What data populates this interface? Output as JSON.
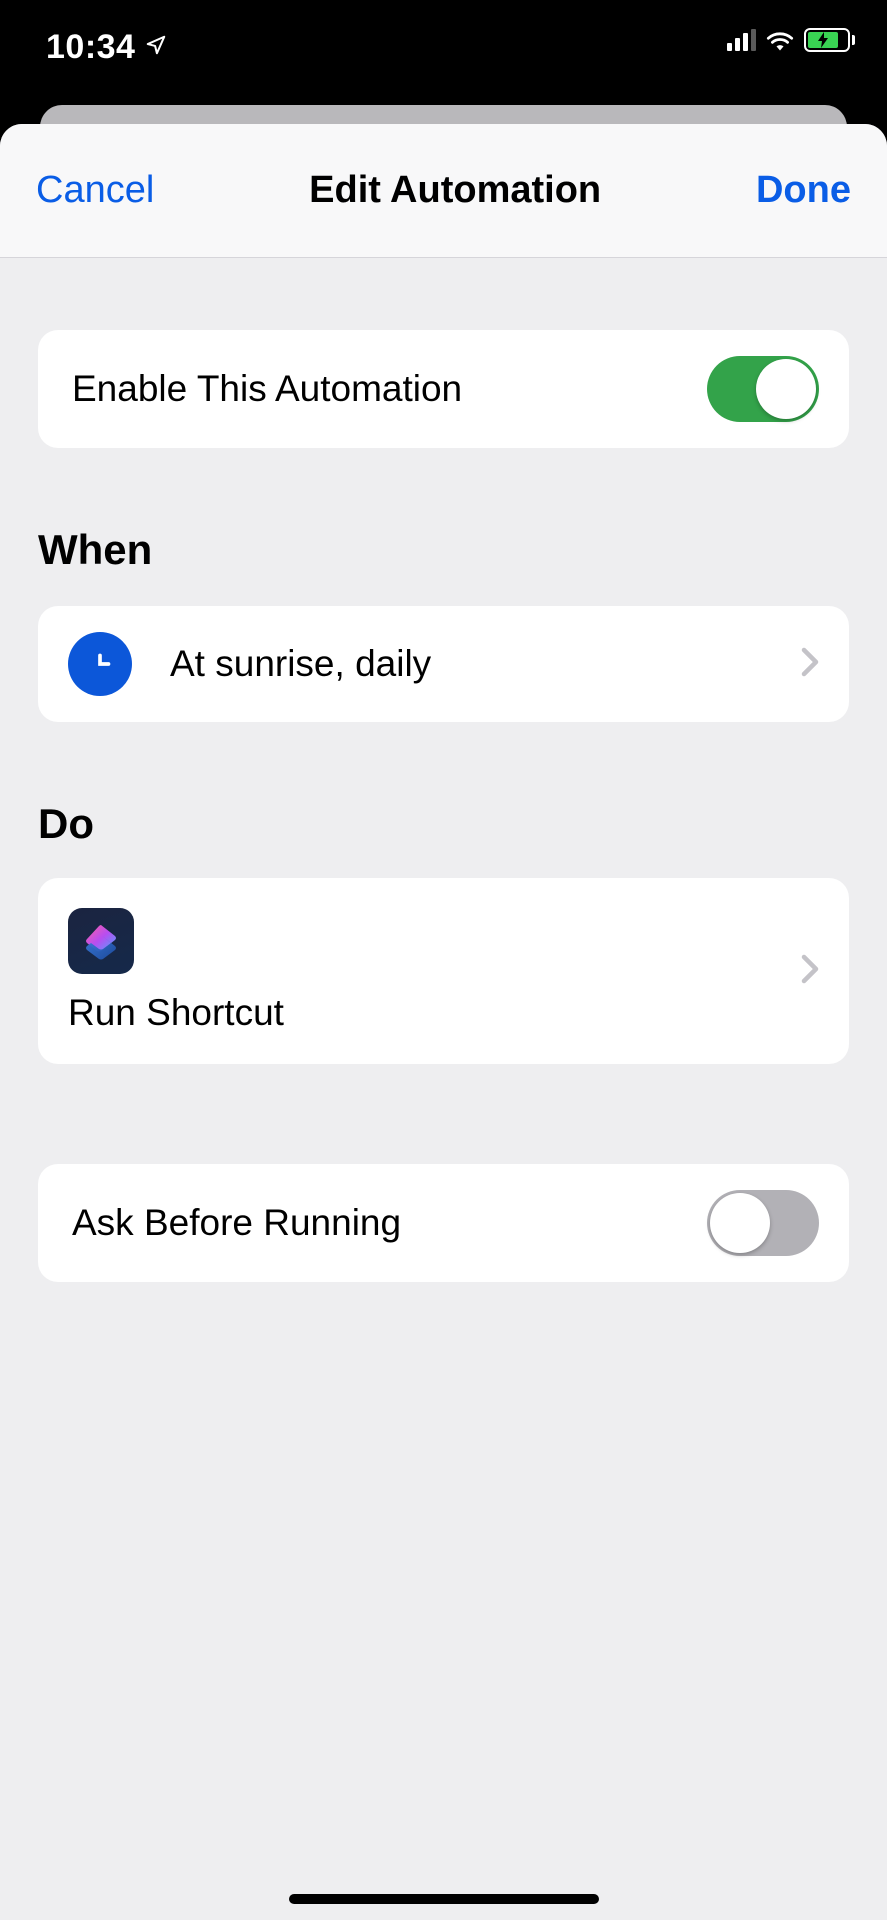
{
  "status": {
    "time": "10:34"
  },
  "nav": {
    "cancel": "Cancel",
    "title": "Edit Automation",
    "done": "Done"
  },
  "enable": {
    "label": "Enable This Automation",
    "on": true
  },
  "sections": {
    "when": "When",
    "do": "Do"
  },
  "when": {
    "icon": "clock-icon",
    "text": "At sunrise, daily"
  },
  "do": {
    "icon": "shortcuts-app-icon",
    "label": "Run Shortcut"
  },
  "ask": {
    "label": "Ask Before Running",
    "on": false
  }
}
